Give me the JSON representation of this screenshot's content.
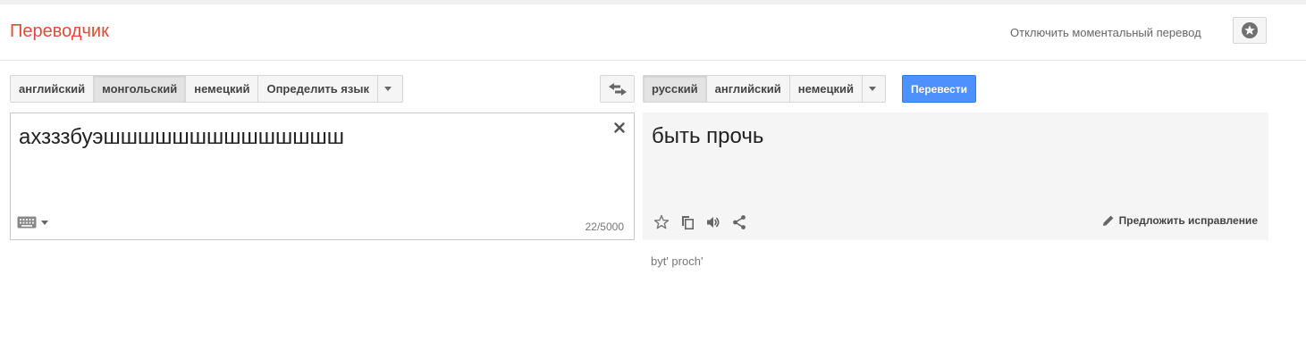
{
  "app": {
    "title": "Переводчик",
    "instant_toggle_label": "Отключить моментальный перевод",
    "star_icon": "star-circle-icon"
  },
  "source_languages": {
    "items": [
      "английский",
      "монгольский",
      "немецкий",
      "Определить язык"
    ],
    "selected": "монгольский"
  },
  "target_languages": {
    "items": [
      "русский",
      "английский",
      "немецкий"
    ],
    "selected": "русский"
  },
  "swap_icon": "swap-arrows-icon",
  "translate_button_label": "Перевести",
  "source_panel": {
    "text": "ахзззбуэшшшшшшшшшшшшшш",
    "char_count": "22/5000",
    "clear_icon": "close-icon",
    "keyboard_icon": "keyboard-icon"
  },
  "target_panel": {
    "text": "быть прочь",
    "transliteration": "byt' proch'",
    "suggest_edit_label": "Предложить исправление",
    "tools": [
      "star-outline-icon",
      "copy-icon",
      "speaker-icon",
      "share-icon"
    ]
  },
  "colors": {
    "brand_red": "#dd4b39",
    "primary_blue": "#4d90fe"
  }
}
